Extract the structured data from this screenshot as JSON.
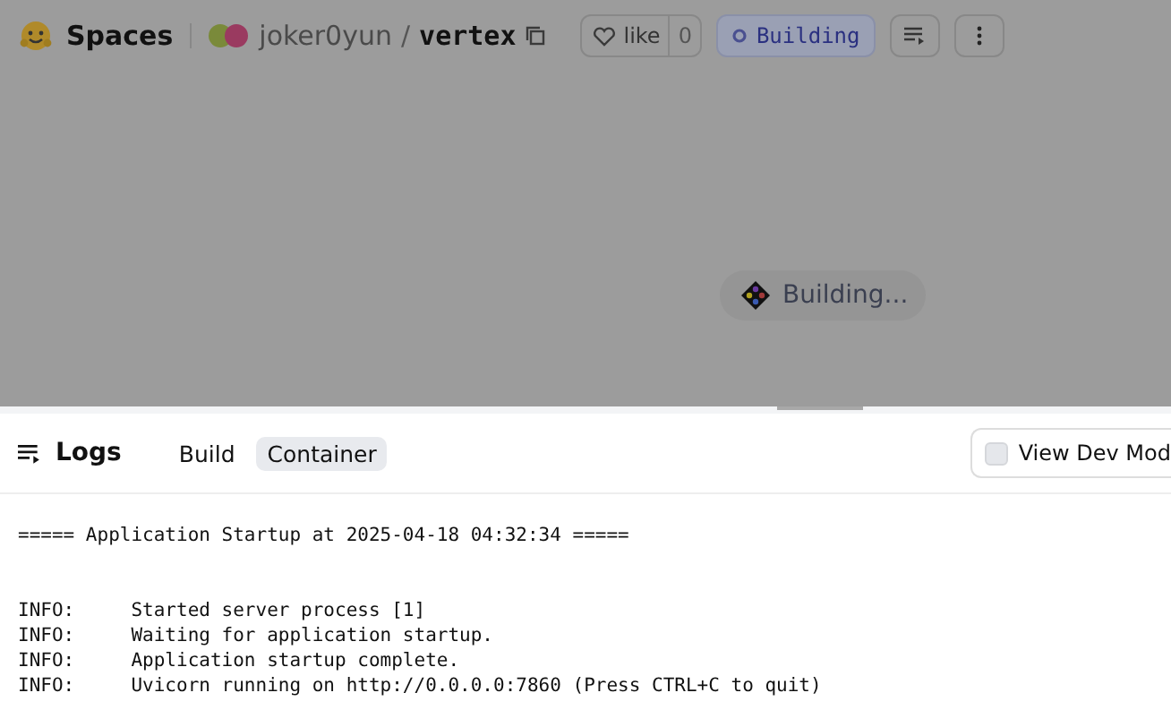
{
  "header": {
    "brand": "Spaces",
    "owner": "joker0yun",
    "separator": "/",
    "repo": "vertex",
    "like_label": "like",
    "like_count": "0",
    "status": "Building"
  },
  "preview": {
    "status": "Building..."
  },
  "logs": {
    "title": "Logs",
    "tabs": [
      {
        "label": "Build",
        "selected": false
      },
      {
        "label": "Container",
        "selected": true
      }
    ],
    "dev_mode": {
      "label": "View Dev Mod",
      "checked": false
    },
    "banner": "===== Application Startup at 2025-04-18 04:32:34 =====",
    "lines": [
      "INFO:     Started server process [1]",
      "INFO:     Waiting for application startup.",
      "INFO:     Application startup complete.",
      "INFO:     Uvicorn running on http://0.0.0.0:7860 (Press CTRL+C to quit)"
    ]
  }
}
